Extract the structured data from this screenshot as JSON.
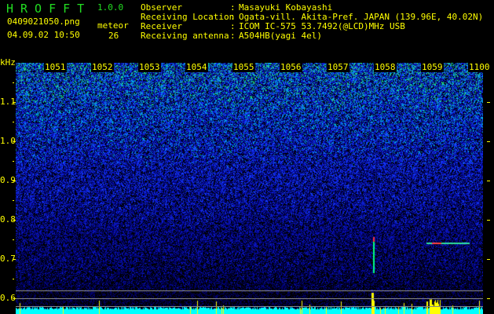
{
  "header": {
    "app_title": "HROFFT",
    "version": "1.0.0",
    "filename": "0409021050.png",
    "datetime": "04.09.02 10:50",
    "meteor_label": "meteor",
    "meteor_count": "26"
  },
  "info": [
    {
      "label": "Observer",
      "value": "Masayuki Kobayashi"
    },
    {
      "label": "Receiving Location",
      "value": "Ogata-vill. Akita-Pref. JAPAN (139.96E, 40.02N)"
    },
    {
      "label": "Receiver",
      "value": "ICOM IC-575 53.7492(@LCD)MHz USB"
    },
    {
      "label": "Receiving antenna",
      "value": "A504HB(yagi 4el)"
    }
  ],
  "separator": ":",
  "spectrogram": {
    "y_unit": "kHz",
    "y_ticks": [
      "1.1",
      "1.0",
      "0.9",
      "0.8",
      "0.7",
      "0.6"
    ],
    "time_labels": [
      "1051",
      "1052",
      "1053",
      "1054",
      "1055",
      "1056",
      "1057",
      "1058",
      "1059",
      "1100"
    ],
    "colors": {
      "text": "#ffff00",
      "title": "#22dd22",
      "noise": "#0000c0",
      "baseline": "#00ffff"
    }
  }
}
